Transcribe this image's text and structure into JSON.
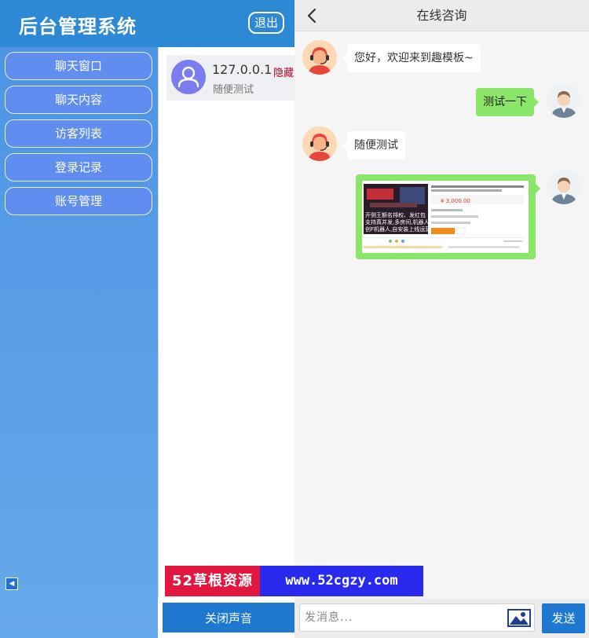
{
  "admin": {
    "title": "后台管理系统",
    "logout_label": "退出",
    "menu": [
      {
        "label": "聊天窗口"
      },
      {
        "label": "聊天内容"
      },
      {
        "label": "访客列表"
      },
      {
        "label": "登录记录"
      },
      {
        "label": "账号管理"
      }
    ],
    "sound_button_label": "关闭声音"
  },
  "visitors": [
    {
      "ip": "127.0.0.1",
      "tag": "隐藏",
      "last_message": "随便测试"
    }
  ],
  "chat": {
    "title": "在线咨询",
    "messages": [
      {
        "from": "agent",
        "text": "您好，欢迎来到趣模板~"
      },
      {
        "from": "user",
        "text": "测试一下"
      },
      {
        "from": "agent",
        "text": "随便测试"
      },
      {
        "from": "user",
        "type": "image"
      }
    ],
    "screenshot_text": {
      "price": "¥ 3,000.00",
      "caption_line1": "开侧王额名排权、发红包",
      "caption_line2": "支持真并发,多房间,机器人",
      "caption_line3": "创F机器人,自安装上线运营"
    },
    "input_placeholder": "发消息...",
    "send_label": "发送"
  },
  "watermark": {
    "left_text": "52草根资源",
    "right_text": "www.52cgzy.com"
  },
  "colors": {
    "header_blue": "#2e89d5",
    "menu_bg": "#5f8df0",
    "bubble_green": "#8be569",
    "button_blue": "#1e78d0"
  }
}
